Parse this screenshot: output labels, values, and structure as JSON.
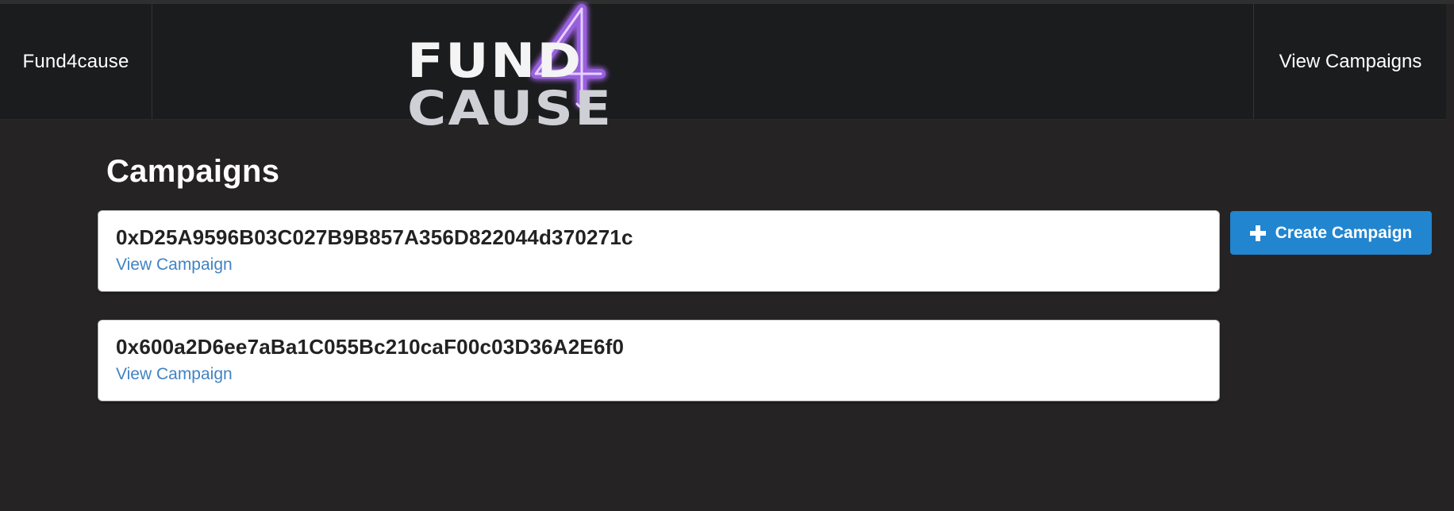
{
  "navbar": {
    "brand_label": "Fund4cause",
    "right_link_label": "View Campaigns",
    "logo": {
      "text_left": "FUND",
      "text_right": "CAUSE",
      "numeral": "4",
      "numeral_color": "#8a3ffc",
      "glow_color": "#b06cff"
    }
  },
  "main": {
    "title": "Campaigns",
    "campaigns": [
      {
        "address": "0xD25A9596B03C027B9B857A356D822044d370271c",
        "link_label": "View Campaign"
      },
      {
        "address": "0x600a2D6ee7aBa1C055Bc210caF00c03D36A2E6f0",
        "link_label": "View Campaign"
      }
    ],
    "create_button": {
      "label": "Create Campaign",
      "icon": "plus-icon",
      "color": "#2185d0"
    }
  },
  "colors": {
    "background": "#252324",
    "navbar": "#1b1c1d",
    "link": "#4183c4"
  }
}
